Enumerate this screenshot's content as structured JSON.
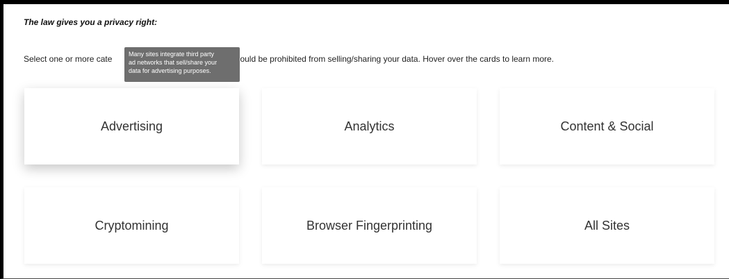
{
  "header": {
    "title": "The law gives you a privacy right:"
  },
  "instruction": {
    "text": "Select one or more cate                                           sites should be prohibited from selling/sharing your data. Hover over the cards to learn more."
  },
  "tooltip": {
    "line1": "Many sites integrate third party",
    "line2": "ad networks that sell/share your",
    "line3": "data for advertising purposes."
  },
  "cards": [
    {
      "label": "Advertising"
    },
    {
      "label": "Analytics"
    },
    {
      "label": "Content & Social"
    },
    {
      "label": "Cryptomining"
    },
    {
      "label": "Browser Fingerprinting"
    },
    {
      "label": "All Sites"
    }
  ],
  "colors": {
    "frame_border": "#000000",
    "tooltip_bg": "#6e6e6e",
    "card_text": "#333333"
  }
}
